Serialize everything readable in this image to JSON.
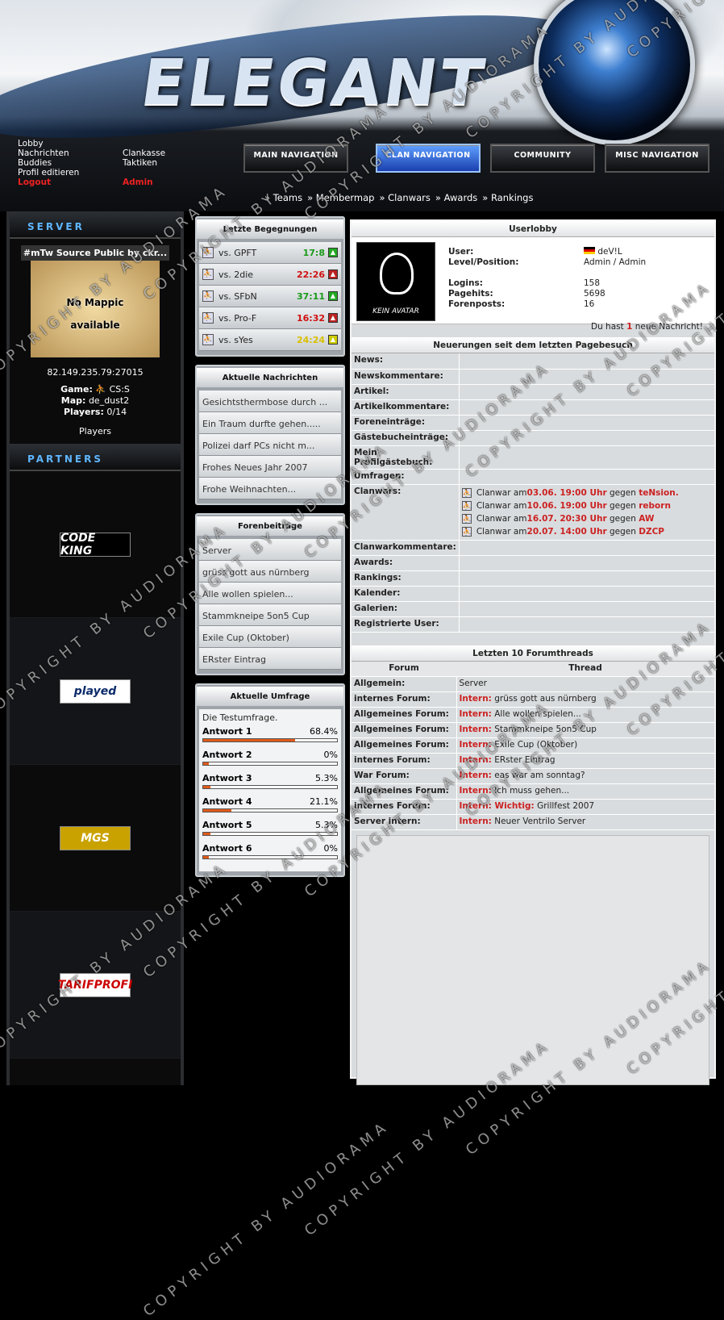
{
  "header": {
    "logo": "ELEGANT",
    "quick_links_left": [
      "Lobby",
      "Nachrichten",
      "Buddies",
      "Profil editieren",
      "Logout"
    ],
    "quick_links_right": [
      "Clankasse",
      "Taktiken",
      "Admin"
    ],
    "nav": [
      "MAIN NAVIGATION",
      "CLAN NAVIGATION",
      "COMMUNITY",
      "MISC NAVIGATION"
    ],
    "subnav": [
      "Teams",
      "Membermap",
      "Clanwars",
      "Awards",
      "Rankings"
    ]
  },
  "left": {
    "server_heading": "SERVER",
    "server_title": "#mTw Source Public by ckr...",
    "map_placeholder_1": "No Mappic",
    "map_placeholder_2": "available",
    "ip": "82.149.235.79:27015",
    "game_label": "Game:",
    "game": "CS:S",
    "map_label": "Map:",
    "map": "de_dust2",
    "players_label": "Players:",
    "players": "0/14",
    "players_link": "Players",
    "partners_heading": "PARTNERS",
    "partners": [
      "CODE KING",
      "played",
      "MGS",
      "TARIFPROFI"
    ]
  },
  "middle": {
    "matches_title": "Letzte Begegnungen",
    "matches": [
      {
        "opp": "vs. GPFT",
        "score": "17:8",
        "color": "#1a9a1a",
        "ind": "#2a2"
      },
      {
        "opp": "vs. 2die",
        "score": "22:26",
        "color": "#d01010",
        "ind": "#b22"
      },
      {
        "opp": "vs. SFbN",
        "score": "37:11",
        "color": "#1a9a1a",
        "ind": "#2a2"
      },
      {
        "opp": "vs. Pro-F",
        "score": "16:32",
        "color": "#d01010",
        "ind": "#b22"
      },
      {
        "opp": "vs. sYes",
        "score": "24:24",
        "color": "#d8c000",
        "ind": "#cc0"
      }
    ],
    "news_title": "Aktuelle Nachrichten",
    "news": [
      "Gesichtsthermbose durch ...",
      "Ein Traum durfte gehen.....",
      "Polizei darf PCs nicht m...",
      "Frohes Neues Jahr 2007",
      "Frohe Weihnachten..."
    ],
    "forum_title": "Forenbeiträge",
    "forum": [
      "Server",
      "grüss gott aus nürnberg",
      "Alle wollen spielen...",
      "Stammkneipe 5on5 Cup",
      "Exile Cup (Oktober)",
      "ERster Eintrag"
    ],
    "poll_title": "Aktuelle Umfrage",
    "poll_question": "Die Testumfrage.",
    "poll_answers": [
      {
        "label": "Antwort 1",
        "pct": "68.4%",
        "frac": 0.684
      },
      {
        "label": "Antwort 2",
        "pct": "0%",
        "frac": 0
      },
      {
        "label": "Antwort 3",
        "pct": "5.3%",
        "frac": 0.053
      },
      {
        "label": "Antwort 4",
        "pct": "21.1%",
        "frac": 0.211
      },
      {
        "label": "Antwort 5",
        "pct": "5.3%",
        "frac": 0.053
      },
      {
        "label": "Antwort 6",
        "pct": "0%",
        "frac": 0
      }
    ]
  },
  "main": {
    "lobby_title": "Userlobby",
    "avatar_caption": "KEIN AVATAR",
    "user_label": "User:",
    "user": "deV!L",
    "level_label": "Level/Position:",
    "level": "Admin / Admin",
    "logins_label": "Logins:",
    "logins": "158",
    "pagehits_label": "Pagehits:",
    "pagehits": "5698",
    "forenposts_label": "Forenposts:",
    "forenposts": "16",
    "msg_pre": "Du hast ",
    "msg_count": "1",
    "msg_post": " neue Nachricht!",
    "news_title": "Neuerungen seit dem letzten Pagebesuch",
    "rows_top": [
      "News:",
      "Newskommentare:",
      "Artikel:",
      "Artikelkommentare:",
      "Foreneinträge:",
      "Gästebucheinträge:",
      "Mein Profilgästebuch:",
      "Umfragen:"
    ],
    "clanwars_label": "Clanwars:",
    "clanwars": [
      {
        "pre": "Clanwar am ",
        "date": "03.06. 19:00 Uhr",
        "mid": " gegen ",
        "team": "teNsion."
      },
      {
        "pre": "Clanwar am ",
        "date": "10.06. 19:00 Uhr",
        "mid": " gegen ",
        "team": "reborn"
      },
      {
        "pre": "Clanwar am ",
        "date": "16.07. 20:30 Uhr",
        "mid": " gegen ",
        "team": "AW"
      },
      {
        "pre": "Clanwar am ",
        "date": "20.07. 14:00 Uhr",
        "mid": " gegen ",
        "team": "DZCP"
      }
    ],
    "rows_bottom": [
      "Clanwarkommentare:",
      "Awards:",
      "Rankings:",
      "Kalender:",
      "Galerien:",
      "Registrierte User:"
    ],
    "threads_title": "Letzten 10 Forumthreads",
    "col_forum": "Forum",
    "col_thread": "Thread",
    "threads": [
      {
        "forum": "Allgemein:",
        "tag": "",
        "thread": "Server"
      },
      {
        "forum": "internes Forum:",
        "tag": "Intern:",
        "thread": " grüss gott aus nürnberg"
      },
      {
        "forum": "Allgemeines Forum:",
        "tag": "Intern:",
        "thread": " Alle wollen spielen..."
      },
      {
        "forum": "Allgemeines Forum:",
        "tag": "Intern:",
        "thread": " Stammkneipe 5on5 Cup"
      },
      {
        "forum": "Allgemeines Forum:",
        "tag": "Intern:",
        "thread": " Exile Cup (Oktober)"
      },
      {
        "forum": "internes Forum:",
        "tag": "Intern:",
        "thread": " ERster Eintrag"
      },
      {
        "forum": "War Forum:",
        "tag": "Intern:",
        "thread": " eas war am sonntag?"
      },
      {
        "forum": "Allgemeines Forum:",
        "tag": "Intern:",
        "thread": " Ich muss gehen..."
      },
      {
        "forum": "internes Forum:",
        "tag": "Intern: Wichtig:",
        "thread": " Grillfest 2007"
      },
      {
        "forum": "Server intern:",
        "tag": "Intern:",
        "thread": " Neuer Ventrilo Server"
      }
    ]
  },
  "watermark": "COPYRIGHT BY AUDIORAMA"
}
